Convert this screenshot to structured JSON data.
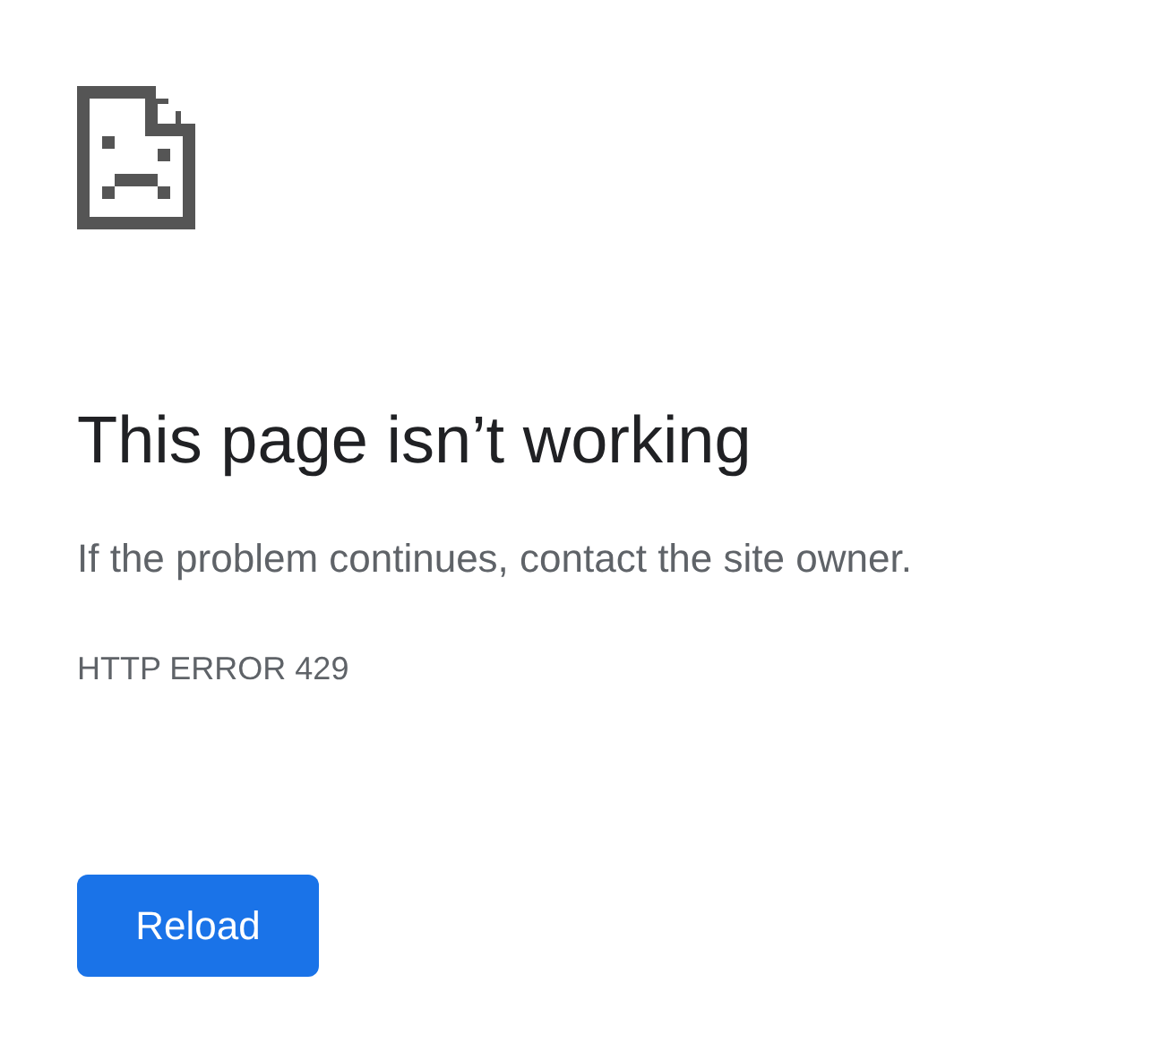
{
  "title": "This page isn’t working",
  "message": "If the problem continues, contact the site owner.",
  "error_code": "HTTP ERROR 429",
  "buttons": [
    "Reload"
  ]
}
